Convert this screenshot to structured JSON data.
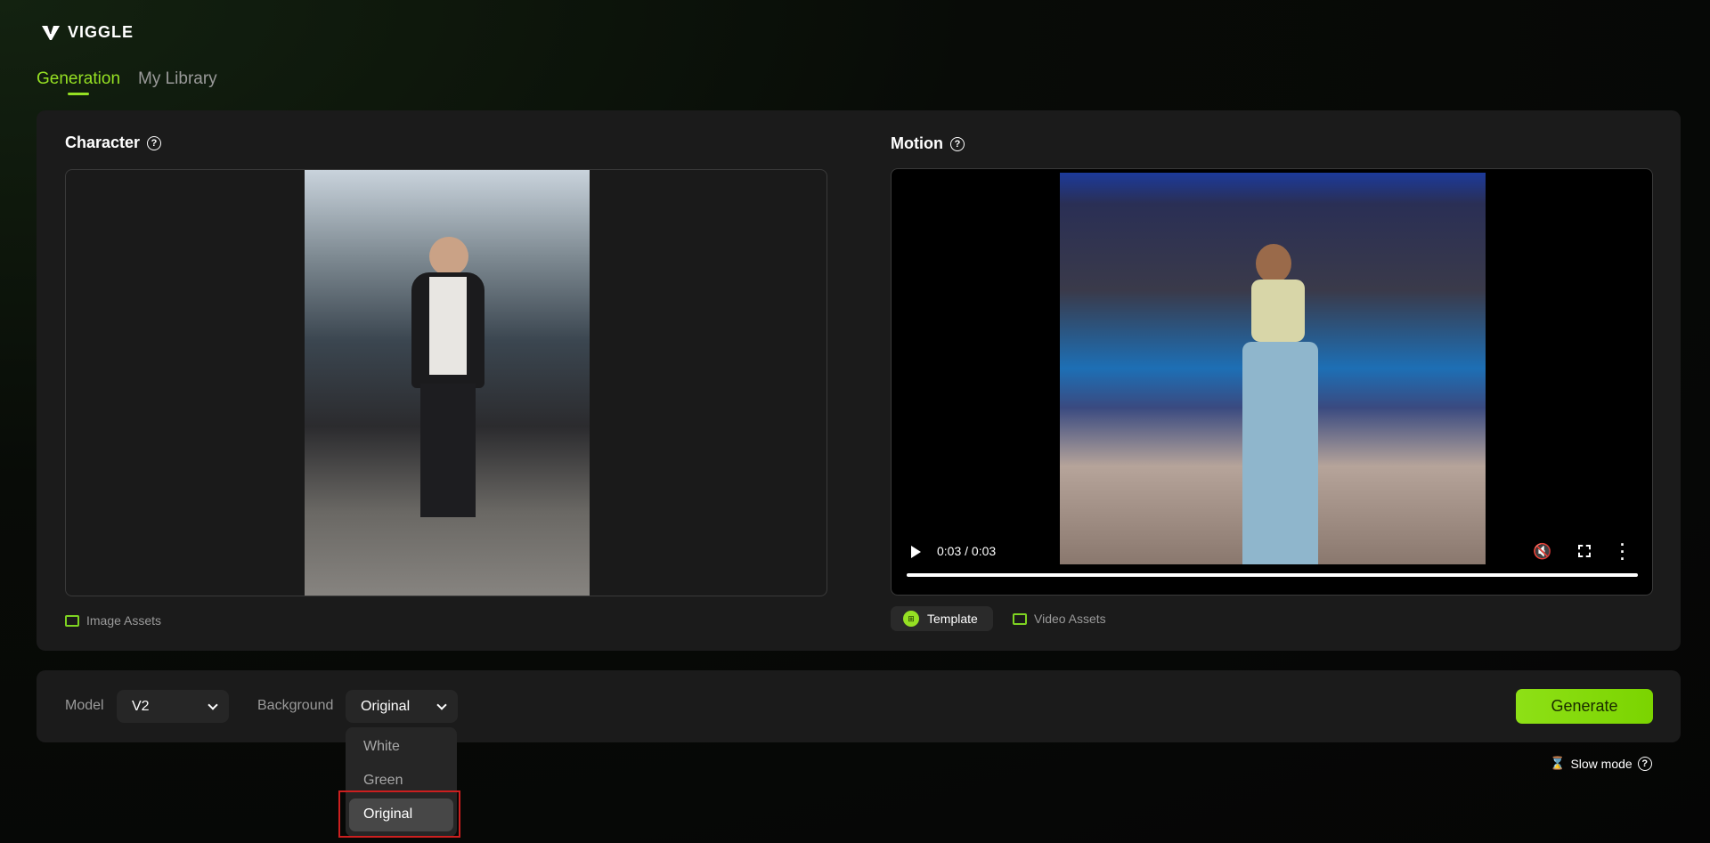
{
  "app": {
    "logo_text": "VIGGLE"
  },
  "tabs": [
    {
      "label": "Generation",
      "active": true
    },
    {
      "label": "My Library",
      "active": false
    }
  ],
  "character": {
    "title": "Character",
    "assets_label": "Image Assets"
  },
  "motion": {
    "title": "Motion",
    "time": "0:03 / 0:03",
    "progress": 1.0,
    "template_label": "Template",
    "assets_label": "Video Assets"
  },
  "settings": {
    "model_label": "Model",
    "model_value": "V2",
    "background_label": "Background",
    "background_value": "Original",
    "background_options": [
      "White",
      "Green",
      "Original"
    ],
    "generate_label": "Generate",
    "slow_mode_label": "Slow mode"
  },
  "colors": {
    "accent": "#95e023",
    "panel": "#1b1b1b",
    "highlight_box": "#cc1f1f"
  }
}
